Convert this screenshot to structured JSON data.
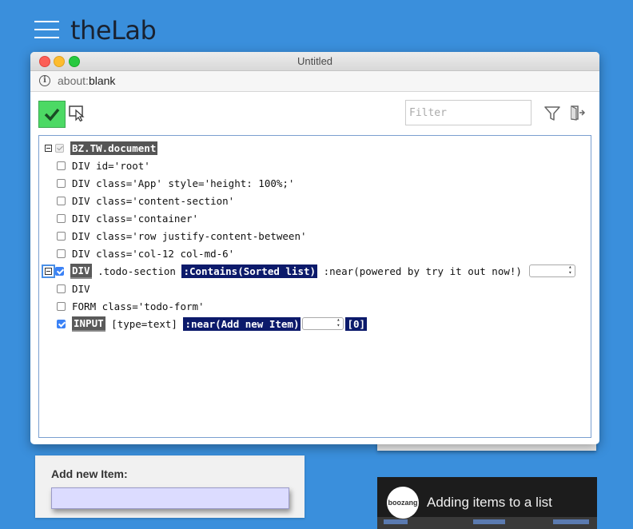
{
  "app": {
    "title": "theLab"
  },
  "window": {
    "title": "Untitled",
    "url_scheme": "about:",
    "url_rest": "blank"
  },
  "toolbar": {
    "filter_placeholder": "Filter"
  },
  "tree": {
    "root": "BZ.TW.document",
    "rows": [
      "DIV id='root'",
      "DIV class='App' style='height: 100%;'",
      "DIV class='content-section'",
      "DIV class='container'",
      "DIV class='row justify-content-between'",
      "DIV class='col-12 col-md-6'"
    ],
    "div_row": {
      "tag": "DIV",
      "cls": " .todo-section ",
      "contains": ":Contains(Sorted list)",
      "near": " :near(powered by try it out now!) "
    },
    "div_plain": "DIV",
    "form_row": "FORM class='todo-form'",
    "input_row": {
      "tag": "INPUT",
      "attr": " [type=text] ",
      "near": ":near(Add new Item)",
      "index": "[0]"
    }
  },
  "add_card": {
    "label": "Add new Item:"
  },
  "video": {
    "logo": "boozang",
    "title": "Adding items to a list"
  },
  "colors": {
    "accent": "#3a8fdc",
    "highlight": "#0c1a6b",
    "check": "#4cd964"
  }
}
